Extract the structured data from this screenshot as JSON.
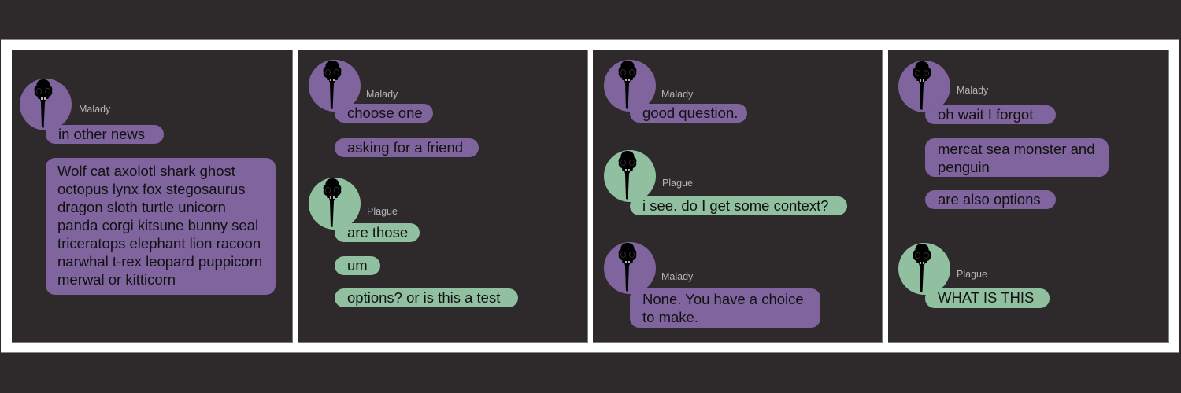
{
  "colors": {
    "background": "#2e292b",
    "frame": "#ffffff",
    "malady": "#7f649d",
    "plague": "#90c0a0",
    "name_text": "#b9b3b6",
    "bubble_text": "#111111"
  },
  "avatar_icon": "bird-skull-icon",
  "panels": [
    {
      "messages": [
        {
          "sender": "Malady",
          "bubbles": [
            "in other news",
            "Wolf cat axolotl shark ghost octopus lynx fox stegosaurus dragon sloth turtle unicorn panda corgi kitsune bunny seal triceratops elephant lion racoon narwhal t-rex leopard puppicorn merwal or kitticorn"
          ]
        }
      ]
    },
    {
      "messages": [
        {
          "sender": "Malady",
          "bubbles": [
            "choose one",
            "asking for a friend"
          ]
        },
        {
          "sender": "Plague",
          "bubbles": [
            "are those",
            "um",
            "options? or is this a test"
          ]
        }
      ]
    },
    {
      "messages": [
        {
          "sender": "Malady",
          "bubbles": [
            "good question."
          ]
        },
        {
          "sender": "Plague",
          "bubbles": [
            "i see. do I get some context?"
          ]
        },
        {
          "sender": "Malady",
          "bubbles": [
            "None. You have a choice to make."
          ]
        }
      ]
    },
    {
      "messages": [
        {
          "sender": "Malady",
          "bubbles": [
            "oh wait I forgot",
            "mercat sea monster and penguin",
            "are also options"
          ]
        },
        {
          "sender": "Plague",
          "bubbles": [
            "WHAT IS THIS"
          ]
        }
      ]
    }
  ]
}
